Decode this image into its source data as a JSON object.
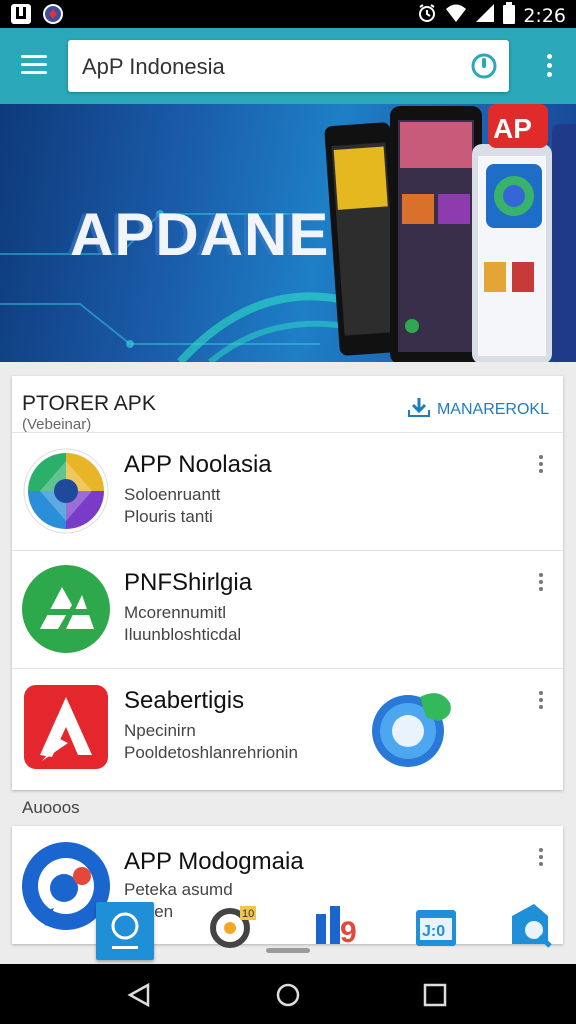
{
  "status_bar": {
    "time": "2:26"
  },
  "toolbar": {
    "search_value": "ApP Indonesia"
  },
  "banner": {
    "title": "APDANE"
  },
  "section": {
    "title": "PTORER APK",
    "subtitle": "(Vebeinar)",
    "manage_label": "MANAREROKL"
  },
  "apps": [
    {
      "title": "APP Noolasia",
      "line1": "Soloenruantt",
      "line2": "Plouris tanti"
    },
    {
      "title": "PNFShirlgia",
      "line1": "Mcorennumitl",
      "line2": "Iluunbloshticdal"
    },
    {
      "title": "Seabertigis",
      "line1": "Npecinirn",
      "line2": "Pooldetoshlanrehrionin"
    }
  ],
  "more_section": {
    "label": "Auooos"
  },
  "featured_app": {
    "title": "APP Modogmaia",
    "line1": "Peteka asumd",
    "line2": "Hoken"
  },
  "dock": {
    "item_badge": "10",
    "item_digit": "9",
    "item_box_text": "J:0"
  },
  "colors": {
    "toolbar": "#2aa7b8",
    "accent": "#1e7cc0",
    "banner_dark": "#0e3a7a"
  }
}
